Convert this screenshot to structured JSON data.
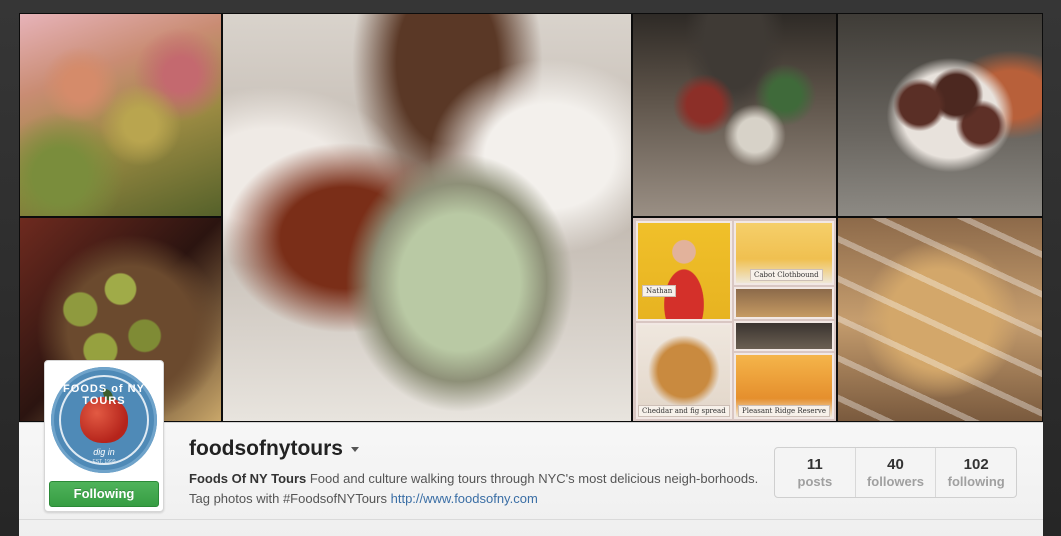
{
  "mosaic": {
    "captions": {
      "nathan": "Nathan",
      "cabot": "Cabot Clothbound",
      "cheddar": "Cheddar and fig spread",
      "pleasant": "Pleasant Ridge Reserve"
    }
  },
  "profile": {
    "username": "foodsofnytours",
    "display_name": "Foods Of NY Tours",
    "bio": " Food and culture walking tours through NYC's most delicious neigh-borhoods. Tag photos with #FoodsofNYTours ",
    "link": "http://www.foodsofny.com",
    "follow_button": "Following",
    "logo": {
      "top_text": "FOODS of NY TOURS",
      "bottom_text": "dig in",
      "est_text": "EST. 1999"
    }
  },
  "stats": [
    {
      "value": "11",
      "label": "posts"
    },
    {
      "value": "40",
      "label": "followers"
    },
    {
      "value": "102",
      "label": "following"
    }
  ],
  "colors": {
    "follow_green": "#43a84f",
    "link_blue": "#3a6ea5",
    "logo_blue": "#4f8ab7"
  }
}
